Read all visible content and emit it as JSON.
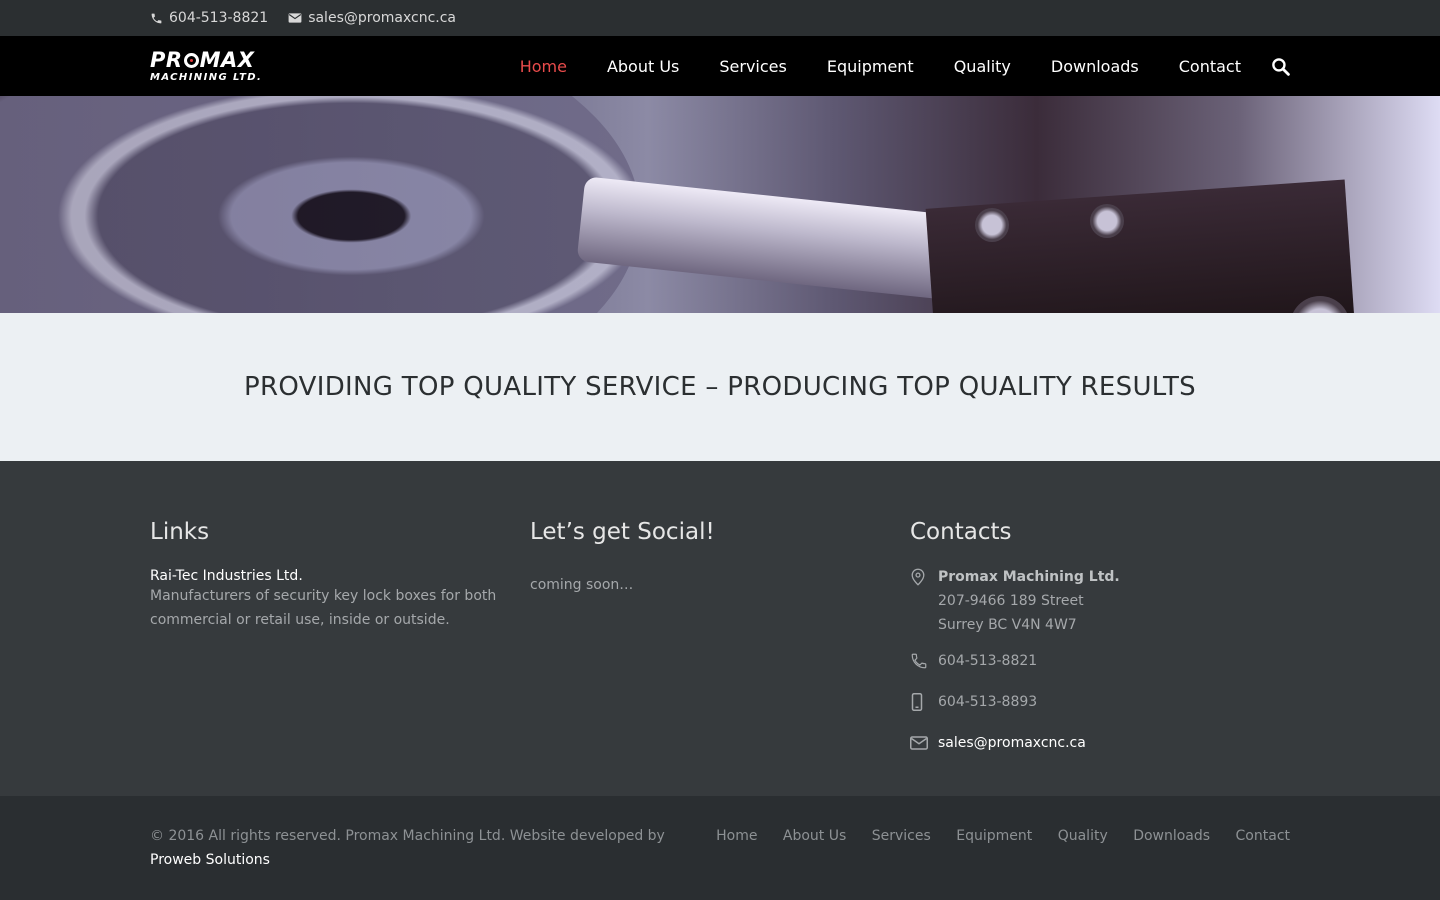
{
  "topbar": {
    "phone": "604-513-8821",
    "email": "sales@promaxcnc.ca"
  },
  "logo": {
    "line1_a": "PR",
    "line1_b": "MAX",
    "line2": "MACHINING LTD."
  },
  "nav": {
    "items": [
      "Home",
      "About Us",
      "Services",
      "Equipment",
      "Quality",
      "Downloads",
      "Contact"
    ],
    "active": "Home"
  },
  "banner": {
    "title": "PROVIDING TOP QUALITY SERVICE – PRODUCING TOP QUALITY RESULTS"
  },
  "footer": {
    "links": {
      "heading": "Links",
      "link_title": "Rai-Tec Industries Ltd.",
      "link_desc": "Manufacturers of security key lock boxes for both commercial or retail use, inside or outside."
    },
    "social": {
      "heading": "Let’s get Social!",
      "text": "coming soon…"
    },
    "contacts": {
      "heading": "Contacts",
      "company": "Promax Machining Ltd.",
      "address1": "207-9466 189 Street",
      "address2": "Surrey BC V4N 4W7",
      "phone": "604-513-8821",
      "mobile": "604-513-8893",
      "email": "sales@promaxcnc.ca"
    }
  },
  "bottom": {
    "copyright": "© 2016 All rights reserved. Promax Machining Ltd. Website developed by ",
    "developer": "Proweb Solutions",
    "nav": [
      "Home",
      "About Us",
      "Services",
      "Equipment",
      "Quality",
      "Downloads",
      "Contact"
    ]
  },
  "colors": {
    "accent": "#e94b4b",
    "nav_bg": "#000000",
    "footer_bg": "#363a3d",
    "banner_bg": "#ecf0f3"
  }
}
